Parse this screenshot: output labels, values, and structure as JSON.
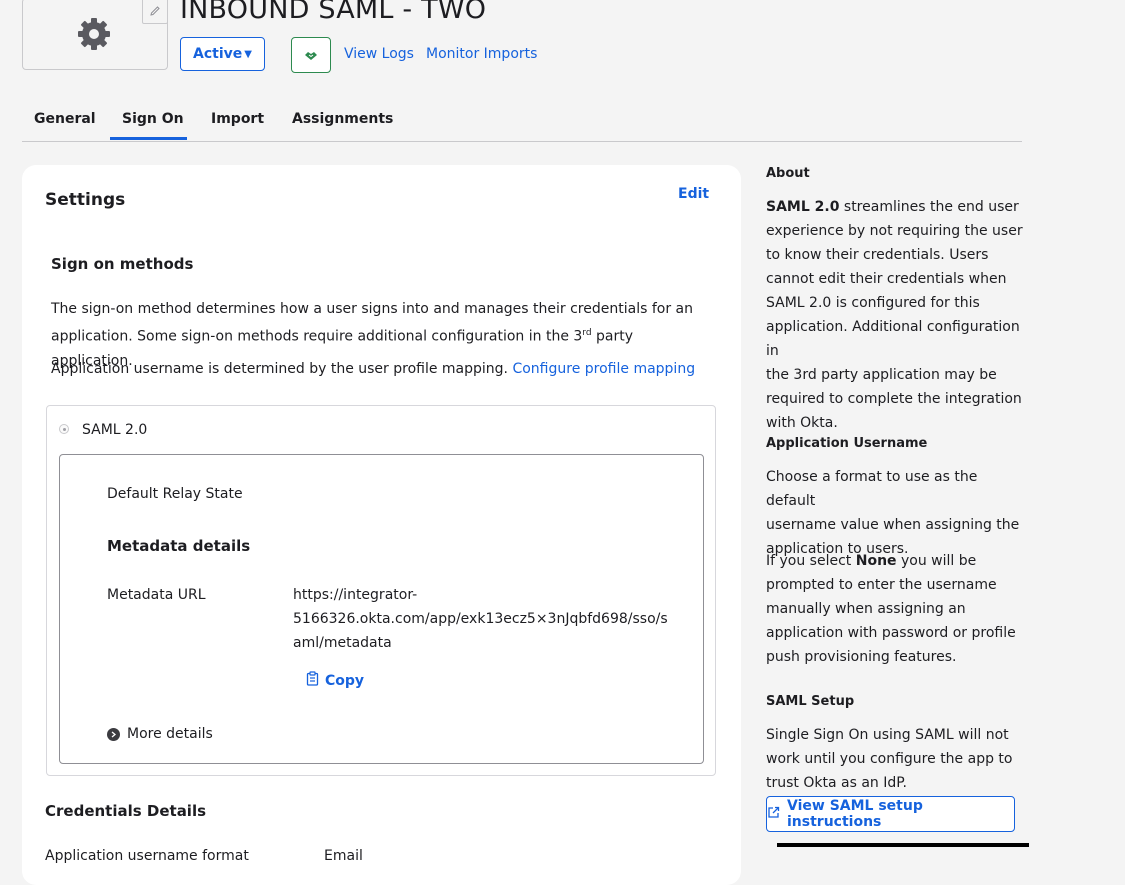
{
  "header": {
    "app_title": "INBOUND SAML - TWO",
    "status_label": "Active",
    "view_logs": "View Logs",
    "monitor_imports": "Monitor Imports"
  },
  "tabs": [
    {
      "label": "General"
    },
    {
      "label": "Sign On"
    },
    {
      "label": "Import"
    },
    {
      "label": "Assignments"
    }
  ],
  "settings": {
    "title": "Settings",
    "edit": "Edit",
    "sign_on_methods_heading": "Sign on methods",
    "desc_line1": "The sign-on method determines how a user signs into and manages their credentials for an",
    "desc_line2_pre": "application. Some sign-on methods require additional configuration in the 3",
    "desc_sup": "rd",
    "desc_line2_post": " party application.",
    "username_text": "Application username is determined by the user profile mapping.",
    "configure_link": "Configure profile mapping",
    "saml_option": "SAML 2.0",
    "relay_state_label": "Default Relay State",
    "metadata_heading": "Metadata details",
    "metadata_url_label": "Metadata URL",
    "metadata_url_line1": "https://integrator-",
    "metadata_url_line2": "5166326.okta.com/app/exk13ecz5×3nJqbfd698/sso/s",
    "metadata_url_line3": "aml/metadata",
    "copy": "Copy",
    "more_details": "More details",
    "credentials_heading": "Credentials Details",
    "username_format_label": "Application username format",
    "username_format_value": "Email"
  },
  "sidebar": {
    "about_heading": "About",
    "about_bold": "SAML 2.0",
    "about_lines": [
      " streamlines the end user",
      "experience by not requiring the user",
      "to know their credentials. Users",
      "cannot edit their credentials when",
      "SAML 2.0 is configured for this",
      "application. Additional configuration in",
      "the 3rd party application may be",
      "required to complete the integration",
      "with Okta."
    ],
    "app_username_heading": "Application Username",
    "app_username_lines": [
      "Choose a format to use as the default",
      "username value when assigning the",
      "application to users."
    ],
    "none_pre": "If you select ",
    "none_bold": "None",
    "none_post": " you will be",
    "none_lines": [
      "prompted to enter the username",
      "manually when assigning an",
      "application with password or profile",
      "push provisioning features."
    ],
    "saml_setup_heading": "SAML Setup",
    "saml_setup_lines": [
      "Single Sign On using SAML will not",
      "work until you configure the app to",
      "trust Okta as an IdP."
    ],
    "saml_setup_button": "View SAML setup instructions"
  },
  "colors": {
    "accent": "#1662dd",
    "success": "#2d8a4f"
  }
}
